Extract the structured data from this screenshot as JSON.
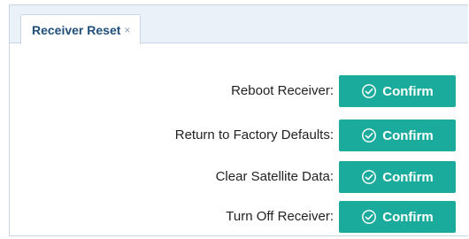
{
  "tab": {
    "label": "Receiver Reset",
    "close_glyph": "×"
  },
  "actions": [
    {
      "label": "Reboot Receiver:",
      "button_label": "Confirm",
      "icon": "check-circle-icon"
    },
    {
      "label": "Return to Factory Defaults:",
      "button_label": "Confirm",
      "icon": "check-circle-icon"
    },
    {
      "label": "Clear Satellite Data:",
      "button_label": "Confirm",
      "icon": "check-circle-icon"
    },
    {
      "label": "Turn Off Receiver:",
      "button_label": "Confirm",
      "icon": "check-circle-icon"
    }
  ],
  "colors": {
    "accent": "#1aab9c",
    "tab_text": "#1f4e79",
    "tabbar_bg": "#eaf1f8",
    "border": "#c9d5e3"
  }
}
